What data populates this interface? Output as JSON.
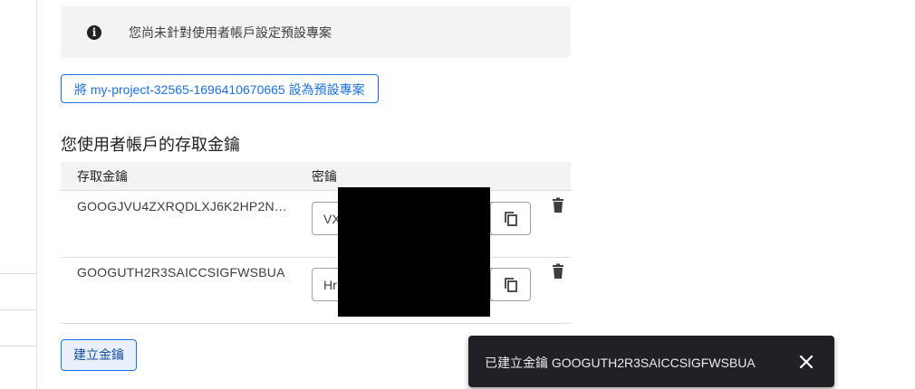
{
  "banner": {
    "text": "您尚未針對使用者帳戶設定預設專案",
    "icon": "info-icon"
  },
  "set_default_button": {
    "label": "將 my-project-32565-1696410670665 設為預設專案"
  },
  "section": {
    "title": "您使用者帳戶的存取金鑰"
  },
  "table": {
    "headers": [
      "存取金鑰",
      "密鑰"
    ],
    "rows": [
      {
        "access_key": "GOOGJVU4ZXRQDLXJ6K2HP2N…",
        "secret_prefix": "VX"
      },
      {
        "access_key": "GOOGUTH2R3SAICCSIGFWSBUA",
        "secret_prefix": "Hr"
      }
    ]
  },
  "create_key_button": {
    "label": "建立金鑰"
  },
  "snackbar": {
    "message": "已建立金鑰 GOOGUTH2R3SAICCSIGFWSBUA"
  },
  "colors": {
    "accent": "#1a73e8",
    "snackbar_bg": "#202124",
    "banner_bg": "#f1f3f4"
  }
}
